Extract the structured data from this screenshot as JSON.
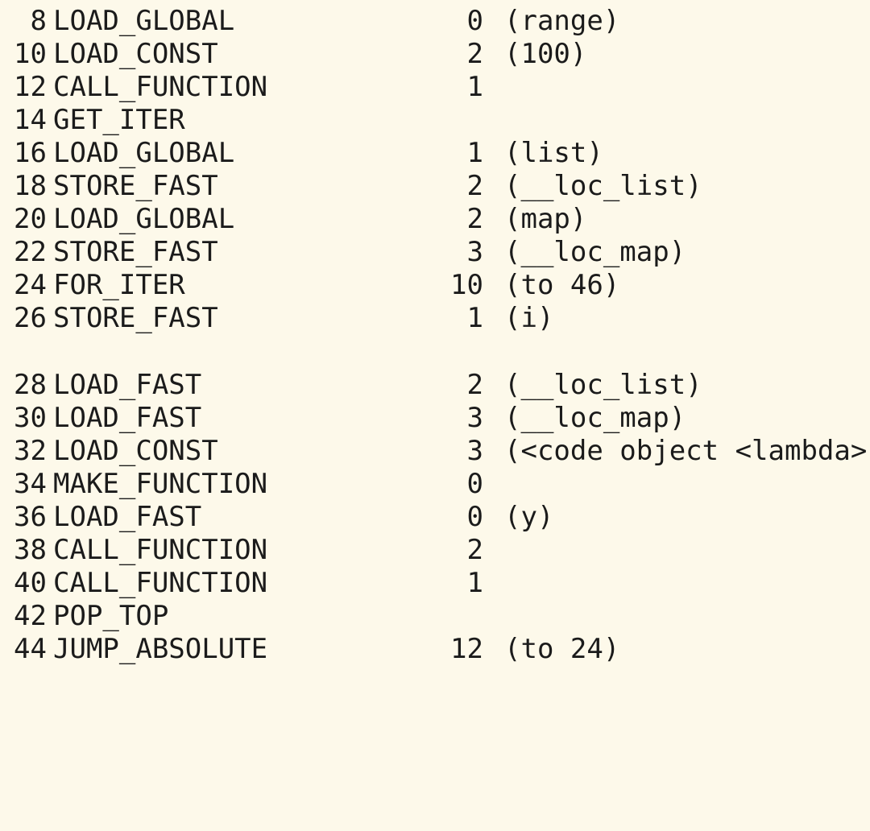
{
  "disassembly": [
    {
      "offset": "8",
      "opname": "LOAD_GLOBAL",
      "arg": "0",
      "argrepr": "(range)"
    },
    {
      "offset": "10",
      "opname": "LOAD_CONST",
      "arg": "2",
      "argrepr": "(100)"
    },
    {
      "offset": "12",
      "opname": "CALL_FUNCTION",
      "arg": "1",
      "argrepr": ""
    },
    {
      "offset": "14",
      "opname": "GET_ITER",
      "arg": "",
      "argrepr": ""
    },
    {
      "offset": "16",
      "opname": "LOAD_GLOBAL",
      "arg": "1",
      "argrepr": "(list)"
    },
    {
      "offset": "18",
      "opname": "STORE_FAST",
      "arg": "2",
      "argrepr": "(__loc_list)"
    },
    {
      "offset": "20",
      "opname": "LOAD_GLOBAL",
      "arg": "2",
      "argrepr": "(map)"
    },
    {
      "offset": "22",
      "opname": "STORE_FAST",
      "arg": "3",
      "argrepr": "(__loc_map)"
    },
    {
      "offset": "24",
      "opname": "FOR_ITER",
      "arg": "10",
      "argrepr": "(to 46)"
    },
    {
      "offset": "26",
      "opname": "STORE_FAST",
      "arg": "1",
      "argrepr": "(i)"
    },
    {
      "offset": "28",
      "opname": "LOAD_FAST",
      "arg": "2",
      "argrepr": "(__loc_list)"
    },
    {
      "offset": "30",
      "opname": "LOAD_FAST",
      "arg": "3",
      "argrepr": "(__loc_map)"
    },
    {
      "offset": "32",
      "opname": "LOAD_CONST",
      "arg": "3",
      "argrepr": "(<code object <lambda>"
    },
    {
      "offset": "34",
      "opname": "MAKE_FUNCTION",
      "arg": "0",
      "argrepr": ""
    },
    {
      "offset": "36",
      "opname": "LOAD_FAST",
      "arg": "0",
      "argrepr": "(y)"
    },
    {
      "offset": "38",
      "opname": "CALL_FUNCTION",
      "arg": "2",
      "argrepr": ""
    },
    {
      "offset": "40",
      "opname": "CALL_FUNCTION",
      "arg": "1",
      "argrepr": ""
    },
    {
      "offset": "42",
      "opname": "POP_TOP",
      "arg": "",
      "argrepr": ""
    },
    {
      "offset": "44",
      "opname": "JUMP_ABSOLUTE",
      "arg": "12",
      "argrepr": "(to 24)"
    }
  ]
}
